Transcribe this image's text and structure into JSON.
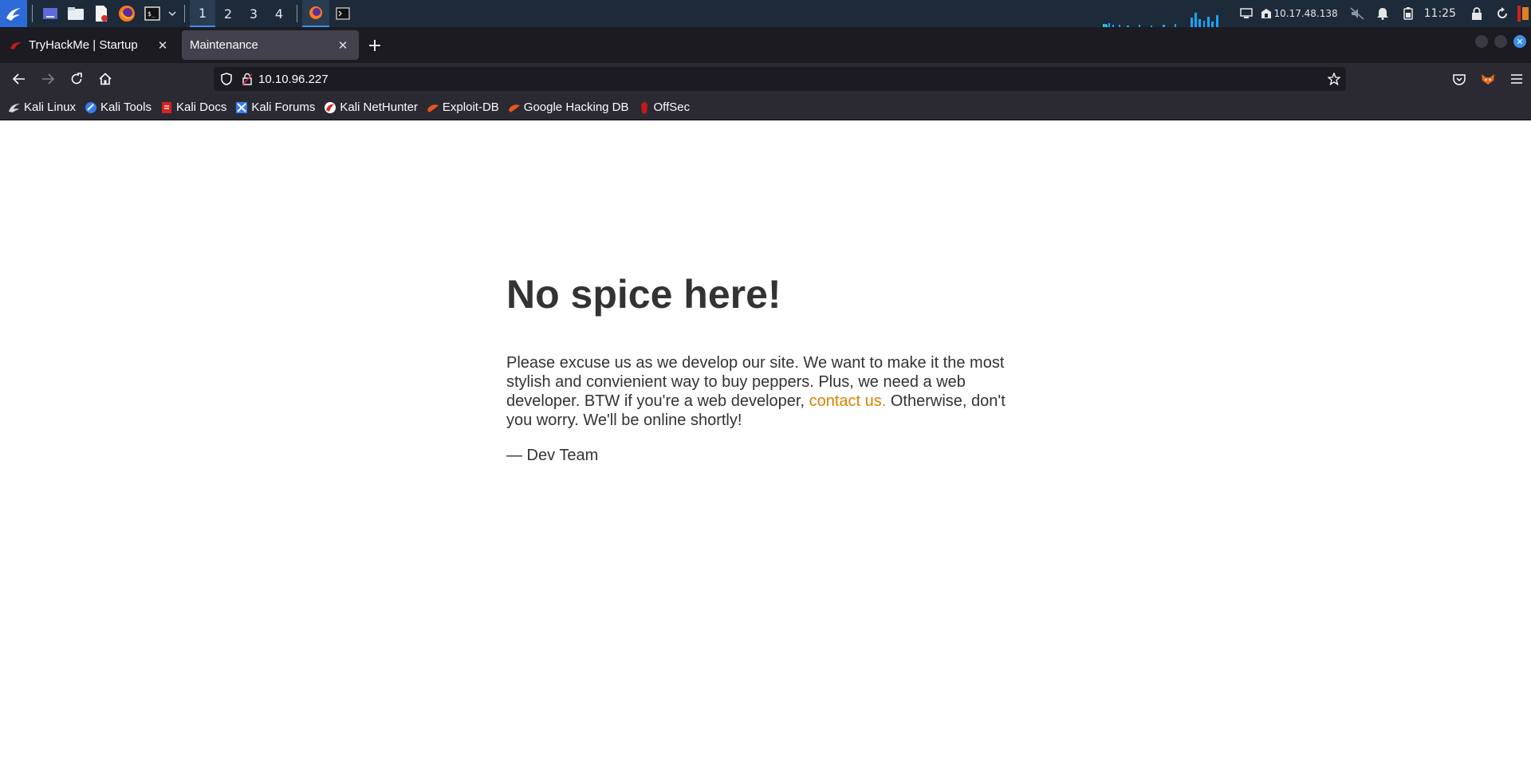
{
  "panel": {
    "workspaces": [
      "1",
      "2",
      "3",
      "4"
    ],
    "active_workspace": "1",
    "ip": "10.17.48.138",
    "clock": "11:25"
  },
  "browser": {
    "tabs": [
      {
        "title": "TryHackMe | Startup",
        "selected": false
      },
      {
        "title": "Maintenance",
        "selected": true
      }
    ],
    "url": "10.10.96.227",
    "bookmarks": [
      {
        "label": "Kali Linux",
        "icon": "kali-dragon-icon"
      },
      {
        "label": "Kali Tools",
        "icon": "kali-tools-icon"
      },
      {
        "label": "Kali Docs",
        "icon": "kali-docs-icon"
      },
      {
        "label": "Kali Forums",
        "icon": "kali-forums-icon"
      },
      {
        "label": "Kali NetHunter",
        "icon": "nethunter-icon"
      },
      {
        "label": "Exploit-DB",
        "icon": "exploit-db-icon"
      },
      {
        "label": "Google Hacking DB",
        "icon": "ghdb-icon"
      },
      {
        "label": "OffSec",
        "icon": "offsec-icon"
      }
    ]
  },
  "page": {
    "heading": "No spice here!",
    "body_before_link": "Please excuse us as we develop our site. We want to make it the most stylish and convienient way to buy peppers. Plus, we need a web developer. BTW if you're a web developer, ",
    "link_text": "contact us.",
    "body_after_link": " Otherwise, don't you worry. We'll be online shortly!",
    "signature": "— Dev Team",
    "link_color": "#dc8100",
    "text_color": "#333333"
  }
}
